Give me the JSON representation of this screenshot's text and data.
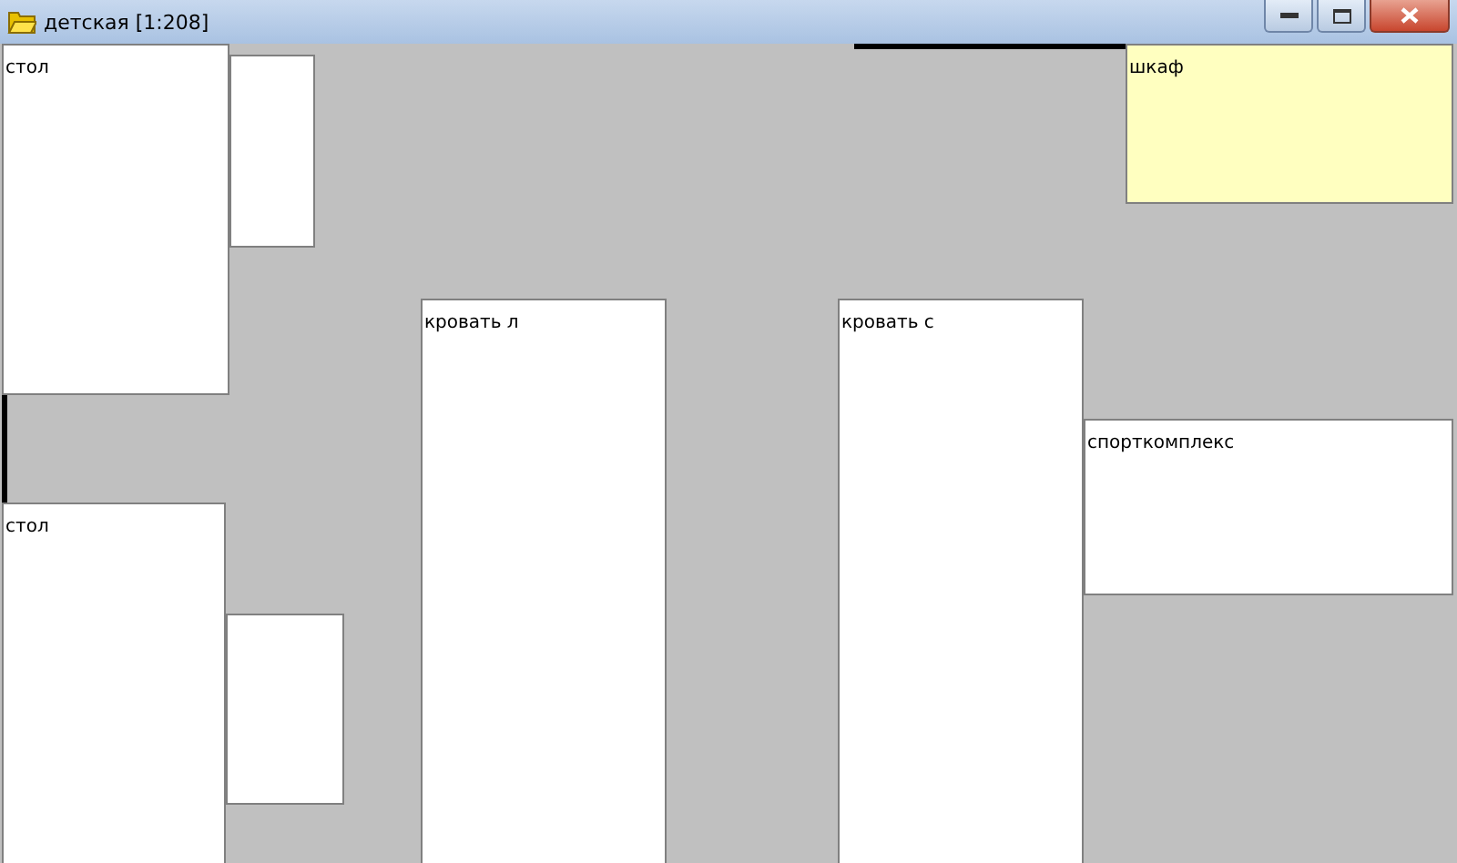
{
  "window": {
    "title": "детская [1:208]"
  },
  "items": [
    {
      "kind": "furniture",
      "label": "стол",
      "color": "#ffffff"
    },
    {
      "kind": "furniture",
      "color": "#ffffff"
    },
    {
      "kind": "furniture",
      "label": "стол",
      "color": "#ffffff"
    },
    {
      "kind": "furniture",
      "color": "#ffffff"
    },
    {
      "kind": "furniture",
      "label": "кровать л",
      "color": "#ffffff"
    },
    {
      "kind": "furniture",
      "label": "кровать с",
      "color": "#ffffff"
    },
    {
      "kind": "furniture",
      "label": "шкаф",
      "color": "#ffffc0"
    },
    {
      "kind": "furniture",
      "label": "спорткомплекс",
      "color": "#ffffff"
    },
    {
      "kind": "opening"
    },
    {
      "kind": "opening"
    }
  ]
}
